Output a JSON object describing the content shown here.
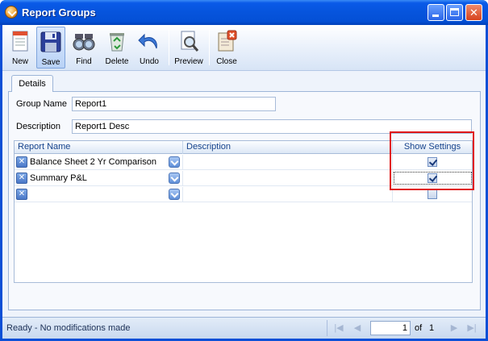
{
  "window": {
    "title": "Report Groups"
  },
  "toolbar": {
    "new": "New",
    "save": "Save",
    "find": "Find",
    "delete": "Delete",
    "undo": "Undo",
    "preview": "Preview",
    "close": "Close"
  },
  "tabs": {
    "details": "Details"
  },
  "form": {
    "group_name_label": "Group Name",
    "group_name_value": "Report1",
    "description_label": "Description",
    "description_value": "Report1 Desc"
  },
  "grid": {
    "columns": [
      "Report Name",
      "Description",
      "Show Settings"
    ],
    "rows": [
      {
        "report_name": "Balance Sheet 2 Yr Comparison",
        "description": "",
        "show_settings": true
      },
      {
        "report_name": "Summary P&L",
        "description": "",
        "show_settings": true
      },
      {
        "report_name": "",
        "description": "",
        "show_settings": false
      }
    ]
  },
  "status": {
    "message": "Ready - No modifications made",
    "page": "1",
    "of_label": "of",
    "total_pages": "1"
  },
  "colors": {
    "highlight_border": "#e01818",
    "title_bar": "#0654dc"
  }
}
